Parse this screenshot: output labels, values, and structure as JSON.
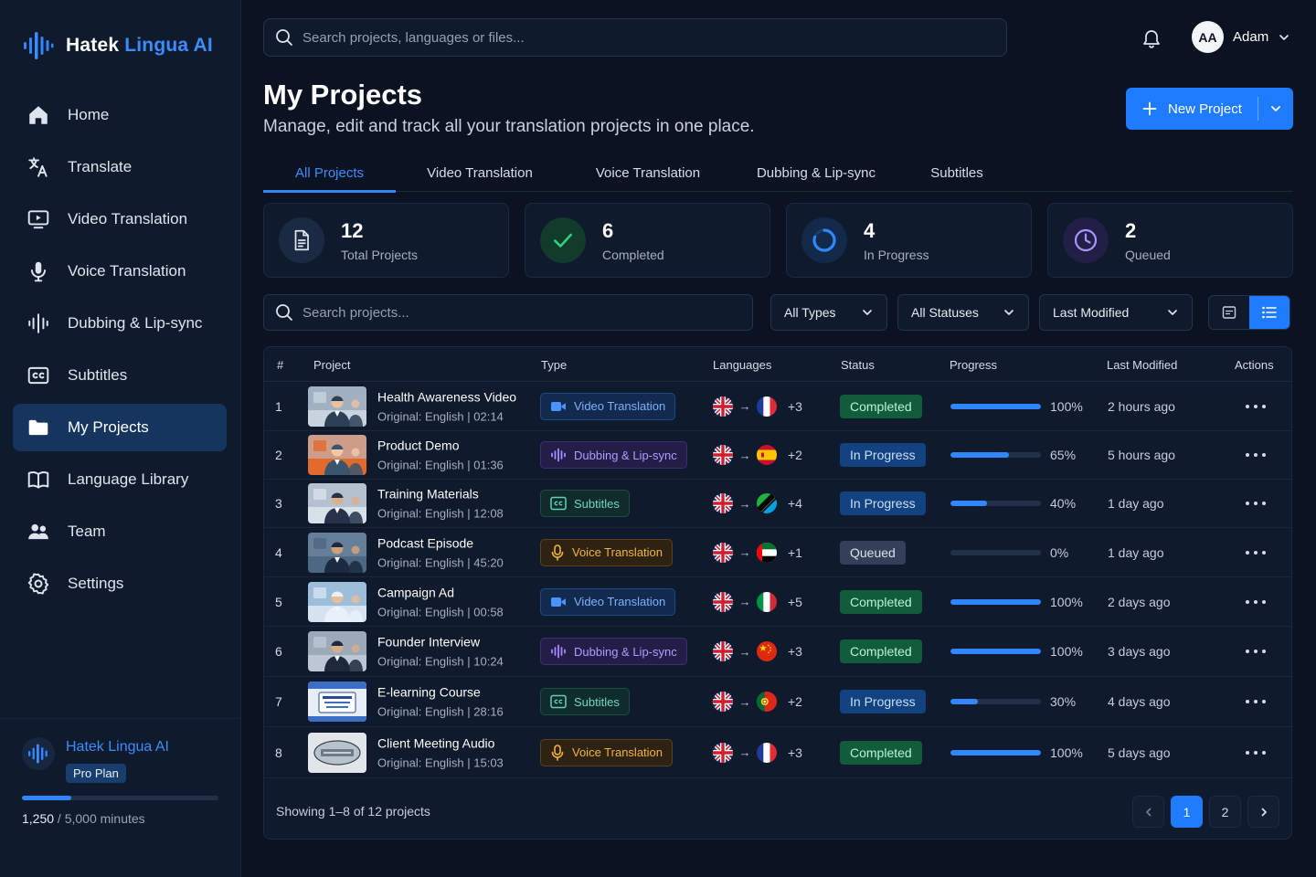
{
  "app": {
    "name_primary": "Hatek",
    "name_accent": "Lingua AI"
  },
  "sidebar": {
    "items": [
      {
        "label": "Home",
        "icon": "home-icon"
      },
      {
        "label": "Translate",
        "icon": "translate-icon"
      },
      {
        "label": "Video Translation",
        "icon": "video-icon"
      },
      {
        "label": "Voice Translation",
        "icon": "microphone-icon"
      },
      {
        "label": "Dubbing & Lip-sync",
        "icon": "waveform-icon"
      },
      {
        "label": "Subtitles",
        "icon": "subtitles-icon"
      },
      {
        "label": "My Projects",
        "icon": "folder-icon",
        "active": true
      },
      {
        "label": "Language Library",
        "icon": "book-icon"
      },
      {
        "label": "Team",
        "icon": "team-icon"
      },
      {
        "label": "Settings",
        "icon": "gear-icon"
      }
    ],
    "plan": {
      "name": "Hatek Lingua AI",
      "badge": "Pro Plan",
      "used": "1,250",
      "total": " / 5,000 minutes",
      "fraction": 0.25
    }
  },
  "topbar": {
    "search_placeholder": "Search projects, languages or files...",
    "user": {
      "initials": "AA",
      "name": "Adam"
    }
  },
  "header": {
    "title": "My Projects",
    "subtitle": "Manage, edit and track all your translation projects in one place.",
    "new_project_label": "New Project"
  },
  "tabs": [
    {
      "label": "All Projects",
      "active": true
    },
    {
      "label": "Video Translation"
    },
    {
      "label": "Voice Translation"
    },
    {
      "label": "Dubbing & Lip-sync"
    },
    {
      "label": "Subtitles"
    }
  ],
  "stats": [
    {
      "value": "12",
      "label": "Total Projects",
      "icon": "document-icon"
    },
    {
      "value": "6",
      "label": "Completed",
      "icon": "check-icon"
    },
    {
      "value": "4",
      "label": "In Progress",
      "icon": "spinner-icon"
    },
    {
      "value": "2",
      "label": "Queued",
      "icon": "clock-icon"
    }
  ],
  "filters": {
    "search_placeholder": "Search projects...",
    "type": "All Types",
    "status": "All Statuses",
    "sort": "Last Modified"
  },
  "table": {
    "columns": [
      "#",
      "Project",
      "Type",
      "Languages",
      "Status",
      "Progress",
      "Last Modified",
      "Actions"
    ],
    "rows": [
      {
        "num": "1",
        "name": "Health Awareness Video",
        "meta": "Original: English  |  02:14",
        "type": "Video Translation",
        "type_key": "video",
        "target_flag": "france",
        "extra": "+3",
        "status": "Completed",
        "status_key": "completed",
        "progress": 100,
        "progress_label": "100%",
        "modified": "2 hours ago"
      },
      {
        "num": "2",
        "name": "Product Demo",
        "meta": "Original: English | 01:36",
        "type": "Dubbing & Lip-sync",
        "type_key": "dub",
        "target_flag": "spain",
        "extra": "+2",
        "status": "In Progress",
        "status_key": "progress",
        "progress": 65,
        "progress_label": "65%",
        "modified": "5 hours ago"
      },
      {
        "num": "3",
        "name": "Training Materials",
        "meta": "Original: English | 12:08",
        "type": "Subtitles",
        "type_key": "sub",
        "target_flag": "tanzania",
        "extra": "+4",
        "status": "In Progress",
        "status_key": "progress",
        "progress": 40,
        "progress_label": "40%",
        "modified": "1 day ago"
      },
      {
        "num": "4",
        "name": "Podcast Episode",
        "meta": "Original: English  |  45:20",
        "type": "Voice Translation",
        "type_key": "voice",
        "target_flag": "uae",
        "extra": "+1",
        "status": "Queued",
        "status_key": "queued",
        "progress": 0,
        "progress_label": "0%",
        "modified": "1 day ago"
      },
      {
        "num": "5",
        "name": "Campaign Ad",
        "meta": "Original: English | 00:58",
        "type": "Video Translation",
        "type_key": "video",
        "target_flag": "italy",
        "extra": "+5",
        "status": "Completed",
        "status_key": "completed",
        "progress": 100,
        "progress_label": "100%",
        "modified": "2 days ago"
      },
      {
        "num": "6",
        "name": "Founder Interview",
        "meta": "Original: English | 10:24",
        "type": "Dubbing & Lip-sync",
        "type_key": "dub",
        "target_flag": "china",
        "extra": "+3",
        "status": "Completed",
        "status_key": "completed",
        "progress": 100,
        "progress_label": "100%",
        "modified": "3 days ago"
      },
      {
        "num": "7",
        "name": "E-learning Course",
        "meta": "Original: English | 28:16",
        "type": "Subtitles",
        "type_key": "sub",
        "target_flag": "portugal",
        "extra": "+2",
        "status": "In Progress",
        "status_key": "progress",
        "progress": 30,
        "progress_label": "30%",
        "modified": "4 days ago"
      },
      {
        "num": "8",
        "name": "Client Meeting Audio",
        "meta": "Original: English | 15:03",
        "type": "Voice Translation",
        "type_key": "voice",
        "target_flag": "france",
        "extra": "+3",
        "status": "Completed",
        "status_key": "completed",
        "progress": 100,
        "progress_label": "100%",
        "modified": "5 days ago"
      }
    ],
    "showing": "Showing 1–8 of 12 projects",
    "pages": [
      "1",
      "2"
    ],
    "current_page": "1"
  },
  "colors": {
    "accent": "#1f7bff",
    "completed": "#115c3b",
    "in_progress": "#12427f",
    "queued": "#34405a"
  }
}
